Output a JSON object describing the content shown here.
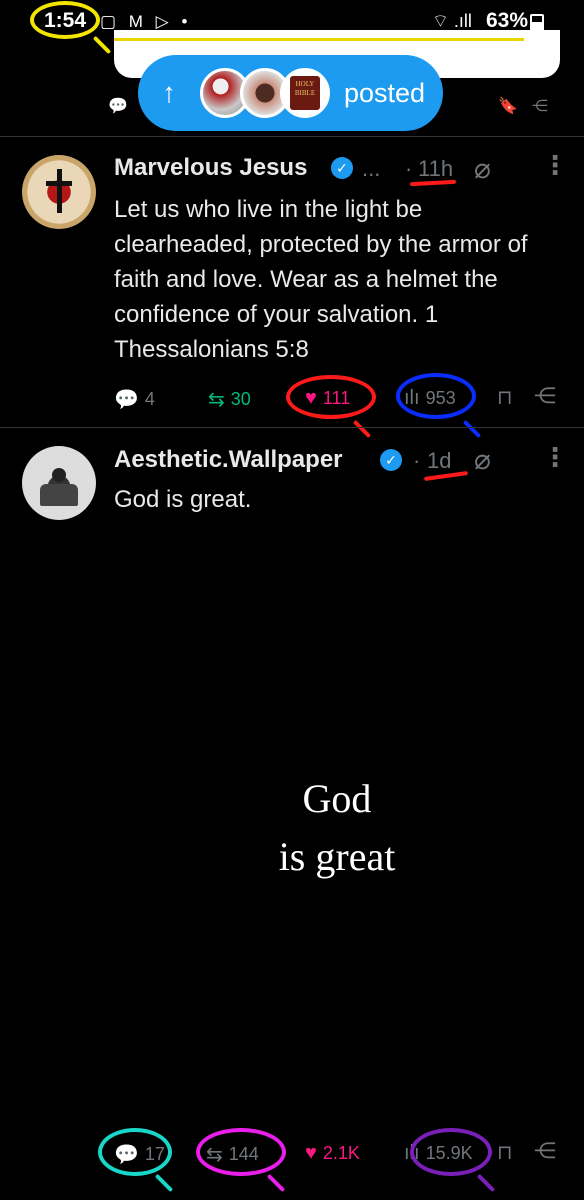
{
  "status_bar": {
    "time": "1:54",
    "notif_icons": "▢ M ▷ •",
    "battery": "63%"
  },
  "pill": {
    "label": "posted",
    "arrow": "↑",
    "bible_text": "HOLY BIBLE"
  },
  "tweets": [
    {
      "author": "Marvelous Jesus",
      "ellipsis": "...",
      "dot": "·",
      "time": "11h",
      "text": "Let us who live in the light be clearheaded, protected by the armor of faith and love.  Wear as a helmet the confidence of your salvation.  1 Thessalonians 5:8",
      "replies": "4",
      "reposts": "30",
      "likes": "111",
      "views": "953",
      "liked": true
    },
    {
      "author": "Aesthetic.Wallpaper",
      "dot": "·",
      "time": "1d",
      "text": "God is great.",
      "media_line1": "God",
      "media_line2": "is great",
      "replies": "17",
      "reposts": "144",
      "likes": "2.1K",
      "views": "15.9K",
      "liked": true
    }
  ],
  "colors": {
    "accent": "#1d9bf0",
    "like": "#f91880",
    "repost": "#00ba7c",
    "annot_yellow": "#f2e600",
    "annot_red": "#ff1a1a",
    "annot_blue": "#0a2cff",
    "annot_cyan": "#18d6c8",
    "annot_magenta": "#e91ee8",
    "annot_purple": "#7a1fb8"
  }
}
